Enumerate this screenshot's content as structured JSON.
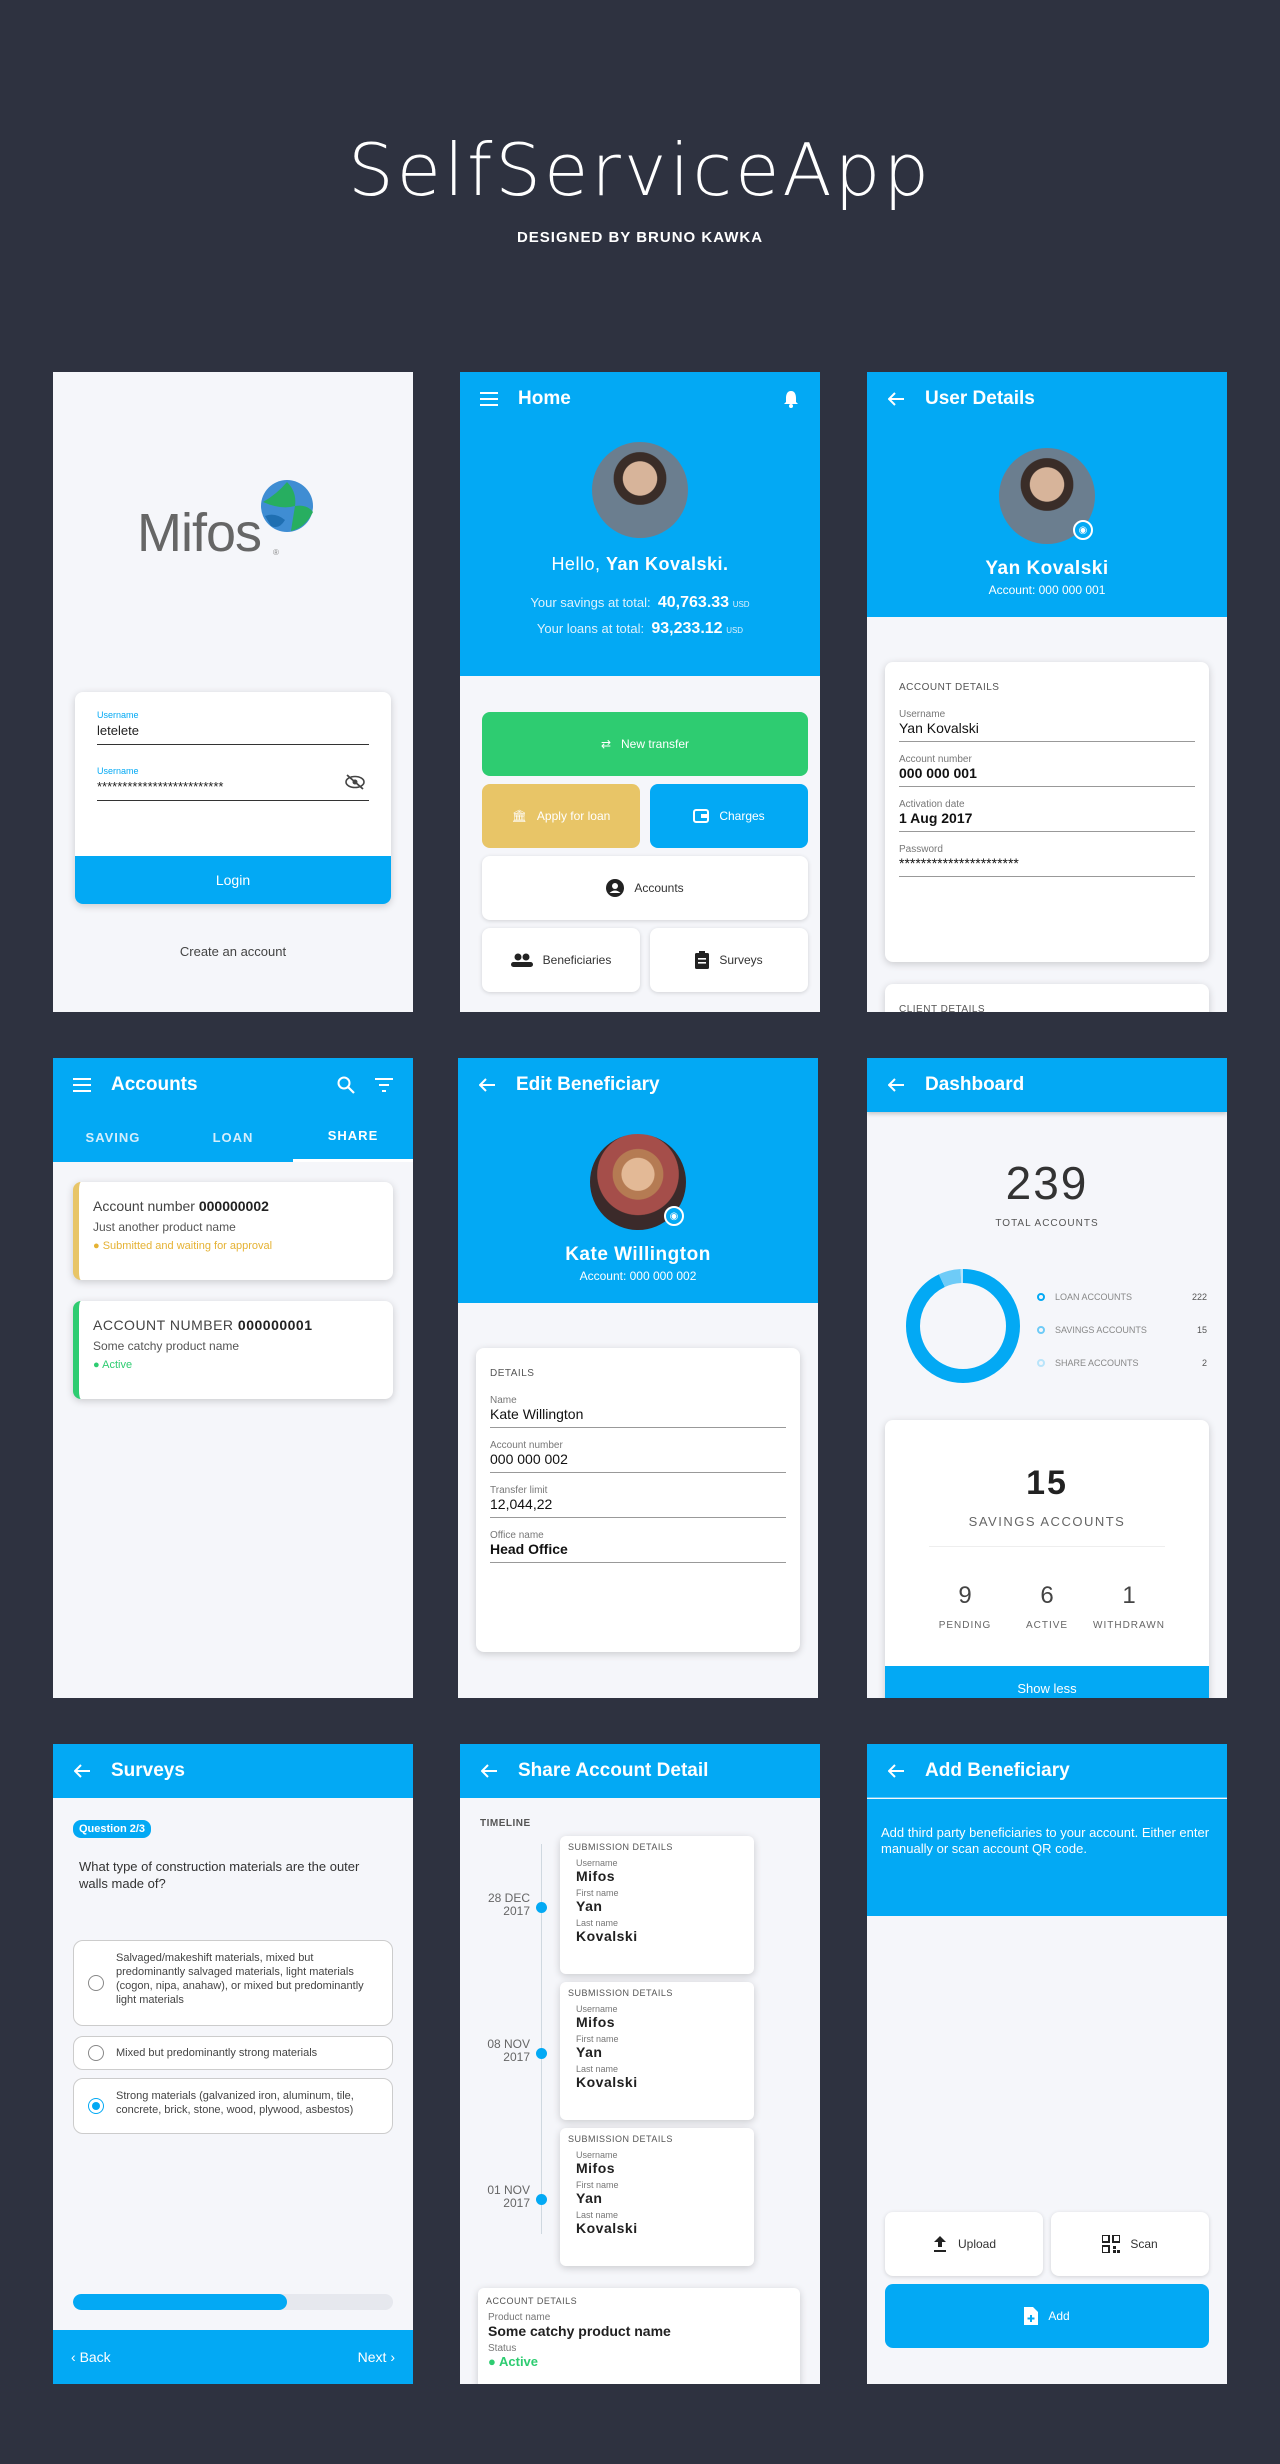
{
  "header": {
    "title": "SelfServiceApp",
    "subtitle": "DESIGNED BY BRUNO KAWKA"
  },
  "colors": {
    "primary": "#03a9f4",
    "green": "#2ecc71",
    "yellow": "#e8c567",
    "background": "#2e3240"
  },
  "login": {
    "logo_text": "Mifos",
    "logo_mark": "®",
    "username_label": "Username",
    "username_value": "letelete",
    "password_label": "Username",
    "password_value": "*************************",
    "login_button": "Login",
    "create_account": "Create an account"
  },
  "home": {
    "title": "Home",
    "greeting": "Hello,",
    "name": "Yan Kovalski.",
    "savings_label": "Your savings at total:",
    "savings_value": "40,763.33",
    "savings_cur": "USD",
    "loans_label": "Your loans at total:",
    "loans_value": "93,233.12",
    "loans_cur": "USD",
    "new_transfer": "New transfer",
    "apply_loan": "Apply for loan",
    "charges": "Charges",
    "accounts": "Accounts",
    "beneficiaries": "Beneficiaries",
    "surveys": "Surveys"
  },
  "user_details": {
    "title": "User Details",
    "name": "Yan Kovalski",
    "account": "Account: 000 000 001",
    "section": "ACCOUNT DETAILS",
    "fields": [
      {
        "label": "Username",
        "value": "Yan Kovalski"
      },
      {
        "label": "Account number",
        "value": "000 000 001"
      },
      {
        "label": "Activation date",
        "value": "1 Aug 2017"
      },
      {
        "label": "Password",
        "value": "**********************"
      }
    ],
    "next_section": "CLIENT DETAILS"
  },
  "accounts": {
    "title": "Accounts",
    "tabs": [
      "SAVING",
      "LOAN",
      "SHARE"
    ],
    "items": [
      {
        "prefix": "Account number",
        "number": "000000002",
        "desc": "Just another product name",
        "status": "Submitted and waiting for approval"
      },
      {
        "prefix": "ACCOUNT NUMBER",
        "number": "000000001",
        "desc": "Some catchy product name",
        "status": "Active"
      }
    ]
  },
  "edit_beneficiary": {
    "title": "Edit Beneficiary",
    "name": "Kate Willington",
    "account": "Account: 000 000 002",
    "section": "DETAILS",
    "fields": [
      {
        "label": "Name",
        "value": "Kate Willington"
      },
      {
        "label": "Account number",
        "value": "000 000 002"
      },
      {
        "label": "Transfer limit",
        "value": "12,044,22"
      },
      {
        "label": "Office name",
        "value": "Head Office"
      }
    ]
  },
  "dashboard": {
    "title": "Dashboard",
    "total": "239",
    "total_label": "TOTAL ACCOUNTS",
    "legend": [
      {
        "label": "LOAN ACCOUNTS",
        "value": "222"
      },
      {
        "label": "SAVINGS ACCOUNTS",
        "value": "15"
      },
      {
        "label": "SHARE ACCOUNTS",
        "value": "2"
      }
    ],
    "donut": {
      "loan": 222,
      "savings": 15,
      "share": 2
    },
    "card_value": "15",
    "card_label": "SAVINGS ACCOUNTS",
    "stats": [
      {
        "value": "9",
        "label": "PENDING"
      },
      {
        "value": "6",
        "label": "ACTIVE"
      },
      {
        "value": "1",
        "label": "WITHDRAWN"
      }
    ],
    "show_less": "Show less"
  },
  "surveys": {
    "title": "Surveys",
    "badge": "Question 2/3",
    "question": "What type of construction materials are the outer walls made of?",
    "options": [
      "Salvaged/makeshift materials, mixed but predominantly salvaged materials, light materials (cogon, nipa, anahaw), or mixed but predominantly light materials",
      "Mixed but predominantly strong materials",
      "Strong materials (galvanized iron, aluminum, tile, concrete, brick, stone, wood, plywood, asbestos)"
    ],
    "selected": 2,
    "progress": 0.67,
    "back": "Back",
    "next": "Next"
  },
  "share_detail": {
    "title": "Share Account Detail",
    "timeline_label": "TIMELINE",
    "entries": [
      {
        "date1": "28 DEC",
        "date2": "2017"
      },
      {
        "date1": "08 NOV",
        "date2": "2017"
      },
      {
        "date1": "01 NOV",
        "date2": "2017"
      }
    ],
    "entry_section": "SUBMISSION DETAILS",
    "entry_fields": [
      {
        "label": "Username",
        "value": "Mifos"
      },
      {
        "label": "First name",
        "value": "Yan"
      },
      {
        "label": "Last name",
        "value": "Kovalski"
      }
    ],
    "account_section": "ACCOUNT DETAILS",
    "product_label": "Product name",
    "product_value": "Some catchy product name",
    "status_label": "Status",
    "status_value": "Active"
  },
  "add_beneficiary": {
    "title": "Add Beneficiary",
    "info": "Add third party beneficiaries to your account. Either enter manually or scan account QR code.",
    "upload": "Upload",
    "scan": "Scan",
    "add": "Add"
  }
}
